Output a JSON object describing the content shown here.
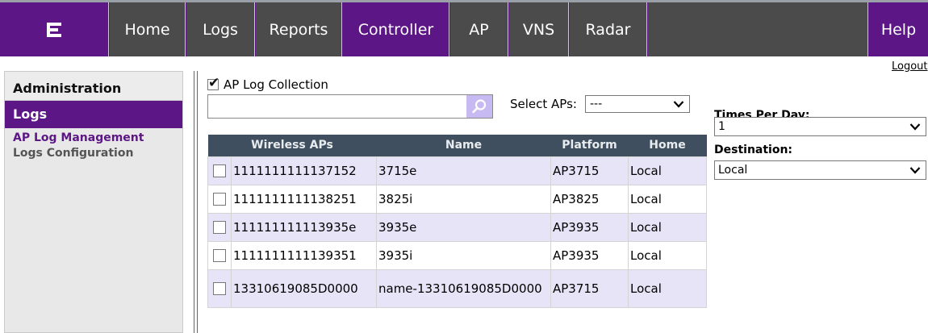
{
  "nav": {
    "logo_icon": "extreme-networks-logo",
    "tabs": [
      {
        "label": "Home"
      },
      {
        "label": "Logs"
      },
      {
        "label": "Reports"
      },
      {
        "label": "Controller"
      },
      {
        "label": "AP"
      },
      {
        "label": "VNS"
      },
      {
        "label": "Radar"
      }
    ],
    "help": "Help"
  },
  "logout": "Logout",
  "sidebar": {
    "section": "Administration",
    "active": "Logs",
    "links": [
      {
        "label": "AP Log Management"
      },
      {
        "label": "Logs Configuration"
      }
    ]
  },
  "main": {
    "collection_label": "AP Log Collection",
    "collection_checked": true,
    "search": {
      "value": "",
      "icon": "search-icon"
    },
    "select_aps_label": "Select APs:",
    "select_aps_value": "---",
    "table": {
      "headers": [
        "Wireless APs",
        "Name",
        "Platform",
        "Home"
      ],
      "rows": [
        {
          "wap": "1111111111137152",
          "name": "3715e",
          "platform": "AP3715",
          "home": "Local"
        },
        {
          "wap": "1111111111138251",
          "name": "3825i",
          "platform": "AP3825",
          "home": "Local"
        },
        {
          "wap": "111111111113935e",
          "name": "3935e",
          "platform": "AP3935",
          "home": "Local"
        },
        {
          "wap": "1111111111139351",
          "name": "3935i",
          "platform": "AP3935",
          "home": "Local"
        },
        {
          "wap": "13310619085D0000",
          "name": "name-13310619085D0000",
          "platform": "AP3715",
          "home": "Local"
        }
      ]
    }
  },
  "right": {
    "times_label": "Times Per Day:",
    "times_value": "1",
    "dest_label": "Destination:",
    "dest_value": "Local"
  },
  "colors": {
    "brand_purple": "#5d1686",
    "nav_gray": "#4b4b4b",
    "row_alt": "#e8e4f7",
    "header_dark": "#3f4f5f"
  }
}
